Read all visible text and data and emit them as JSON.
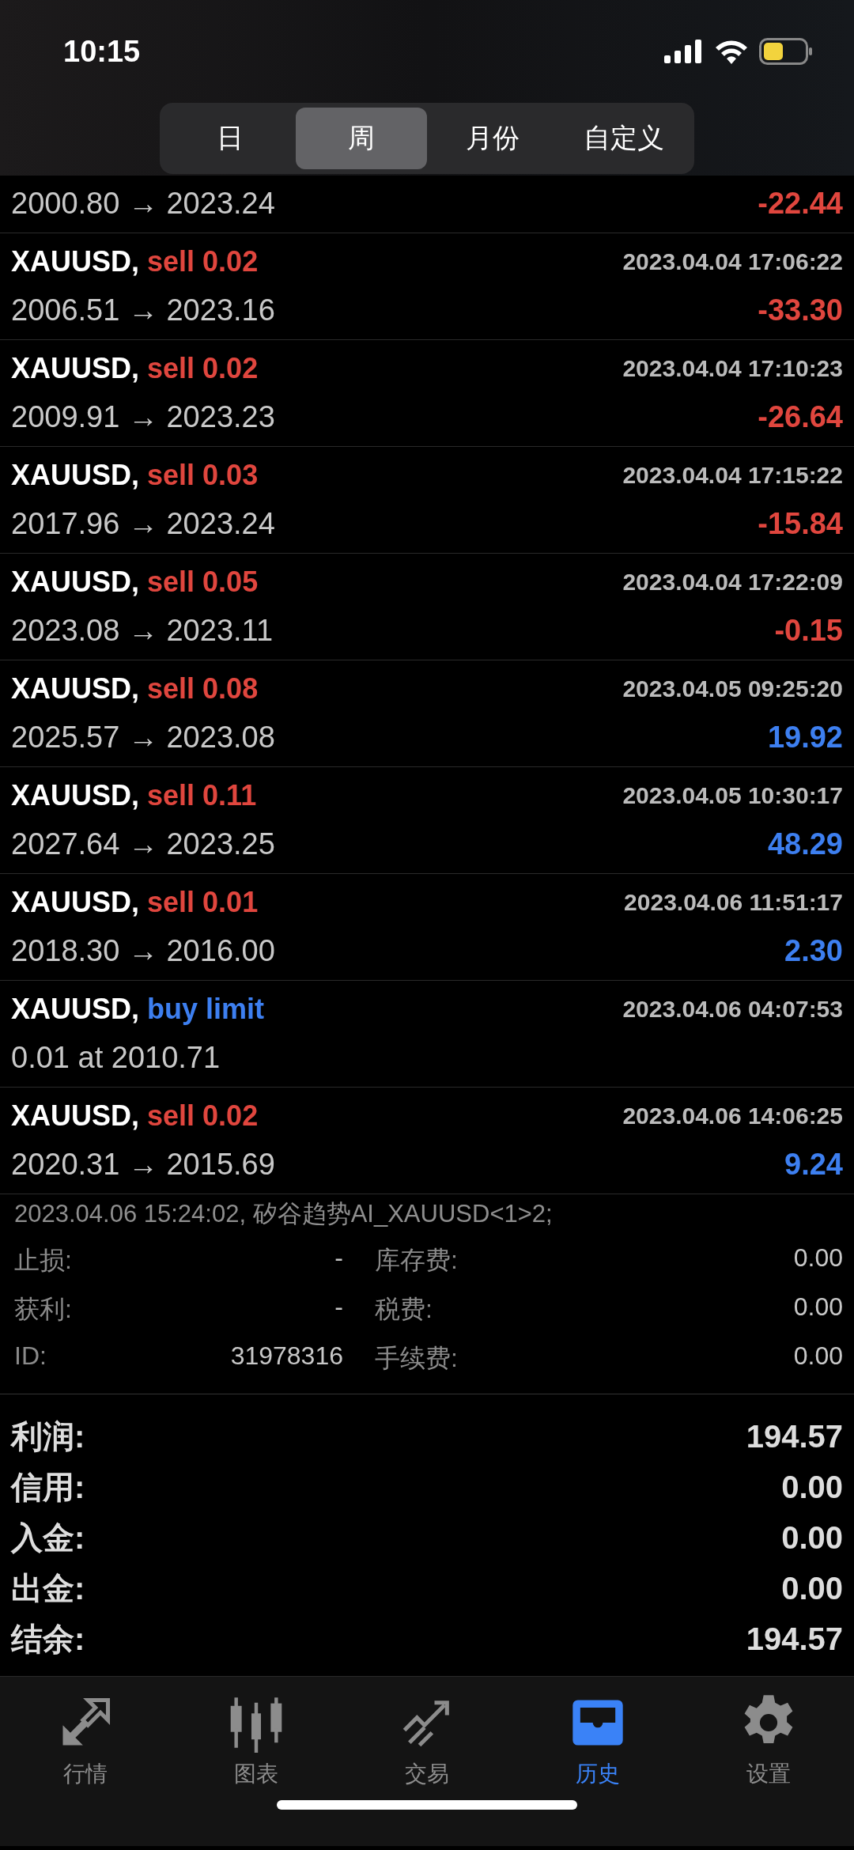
{
  "status_bar": {
    "time": "10:15"
  },
  "period_tabs": [
    {
      "label": "日",
      "selected": false
    },
    {
      "label": "周",
      "selected": true
    },
    {
      "label": "月份",
      "selected": false
    },
    {
      "label": "自定义",
      "selected": false
    }
  ],
  "partial_row": {
    "prices": "2000.80 → 2023.24",
    "profit": "-22.44",
    "loss": true
  },
  "rows": [
    {
      "kind": "deal",
      "symbol": "XAUUSD,",
      "type": "sell 0.02",
      "buy": false,
      "time": "2023.04.04 17:06:22",
      "prices": "2006.51 → 2023.16",
      "profit": "-33.30",
      "loss": true
    },
    {
      "kind": "deal",
      "symbol": "XAUUSD,",
      "type": "sell 0.02",
      "buy": false,
      "time": "2023.04.04 17:10:23",
      "prices": "2009.91 → 2023.23",
      "profit": "-26.64",
      "loss": true
    },
    {
      "kind": "deal",
      "symbol": "XAUUSD,",
      "type": "sell 0.03",
      "buy": false,
      "time": "2023.04.04 17:15:22",
      "prices": "2017.96 → 2023.24",
      "profit": "-15.84",
      "loss": true
    },
    {
      "kind": "deal",
      "symbol": "XAUUSD,",
      "type": "sell 0.05",
      "buy": false,
      "time": "2023.04.04 17:22:09",
      "prices": "2023.08 → 2023.11",
      "profit": "-0.15",
      "loss": true
    },
    {
      "kind": "deal",
      "symbol": "XAUUSD,",
      "type": "sell 0.08",
      "buy": false,
      "time": "2023.04.05 09:25:20",
      "prices": "2025.57 → 2023.08",
      "profit": "19.92",
      "loss": false
    },
    {
      "kind": "deal",
      "symbol": "XAUUSD,",
      "type": "sell 0.11",
      "buy": false,
      "time": "2023.04.05 10:30:17",
      "prices": "2027.64 → 2023.25",
      "profit": "48.29",
      "loss": false
    },
    {
      "kind": "deal",
      "symbol": "XAUUSD,",
      "type": "sell 0.01",
      "buy": false,
      "time": "2023.04.06 11:51:17",
      "prices": "2018.30 → 2016.00",
      "profit": "2.30",
      "loss": false
    },
    {
      "kind": "order",
      "symbol": "XAUUSD,",
      "type": "buy limit",
      "buy": true,
      "time": "2023.04.06 04:07:53",
      "prices": "0.01 at 2010.71"
    },
    {
      "kind": "deal",
      "symbol": "XAUUSD,",
      "type": "sell 0.02",
      "buy": false,
      "time": "2023.04.06 14:06:25",
      "prices": "2020.31 → 2015.69",
      "profit": "9.24",
      "loss": false,
      "expanded": true,
      "details": {
        "comment": "2023.04.06 15:24:02, 矽谷趋势AI_XAUUSD<1>2;",
        "fields": [
          {
            "label": "止损:",
            "value": "-"
          },
          {
            "label": "库存费:",
            "value": "0.00"
          },
          {
            "label": "获利:",
            "value": "-"
          },
          {
            "label": "税费:",
            "value": "0.00"
          },
          {
            "label": "ID:",
            "value": "31978316"
          },
          {
            "label": "手续费:",
            "value": "0.00"
          }
        ]
      }
    }
  ],
  "summary": [
    {
      "label": "利润:",
      "value": "194.57"
    },
    {
      "label": "信用:",
      "value": "0.00"
    },
    {
      "label": "入金:",
      "value": "0.00"
    },
    {
      "label": "出金:",
      "value": "0.00"
    },
    {
      "label": "结余:",
      "value": "194.57"
    }
  ],
  "tab_bar": [
    {
      "label": "行情",
      "selected": false
    },
    {
      "label": "图表",
      "selected": false
    },
    {
      "label": "交易",
      "selected": false
    },
    {
      "label": "历史",
      "selected": true
    },
    {
      "label": "设置",
      "selected": false
    }
  ]
}
